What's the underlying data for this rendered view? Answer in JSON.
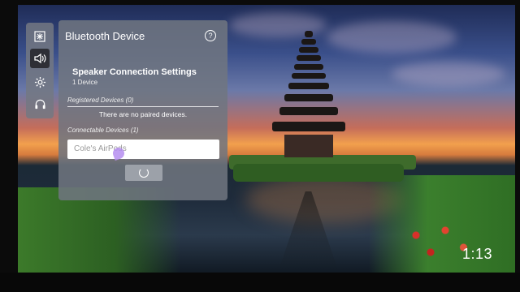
{
  "panel": {
    "title": "Bluetooth Device",
    "help_icon": "help-circle-icon",
    "section_title": "Speaker Connection Settings",
    "section_subtitle": "1 Device",
    "registered_label": "Registered Devices (0)",
    "no_devices_text": "There are no paired devices.",
    "connectable_label": "Connectable Devices (1)",
    "connectable_devices": [
      "Cole's AirPods"
    ],
    "searching_indicator": "spinner-icon"
  },
  "rail": {
    "icons": [
      "settings-snowflake-icon",
      "speaker-volume-icon",
      "gear-icon",
      "headset-icon"
    ],
    "active_index": 1
  },
  "overlay": {
    "clock": "1:13"
  },
  "colors": {
    "panel_bg": "#70767f",
    "field_bg": "#ffffff",
    "field_text": "#9a9a9a"
  }
}
